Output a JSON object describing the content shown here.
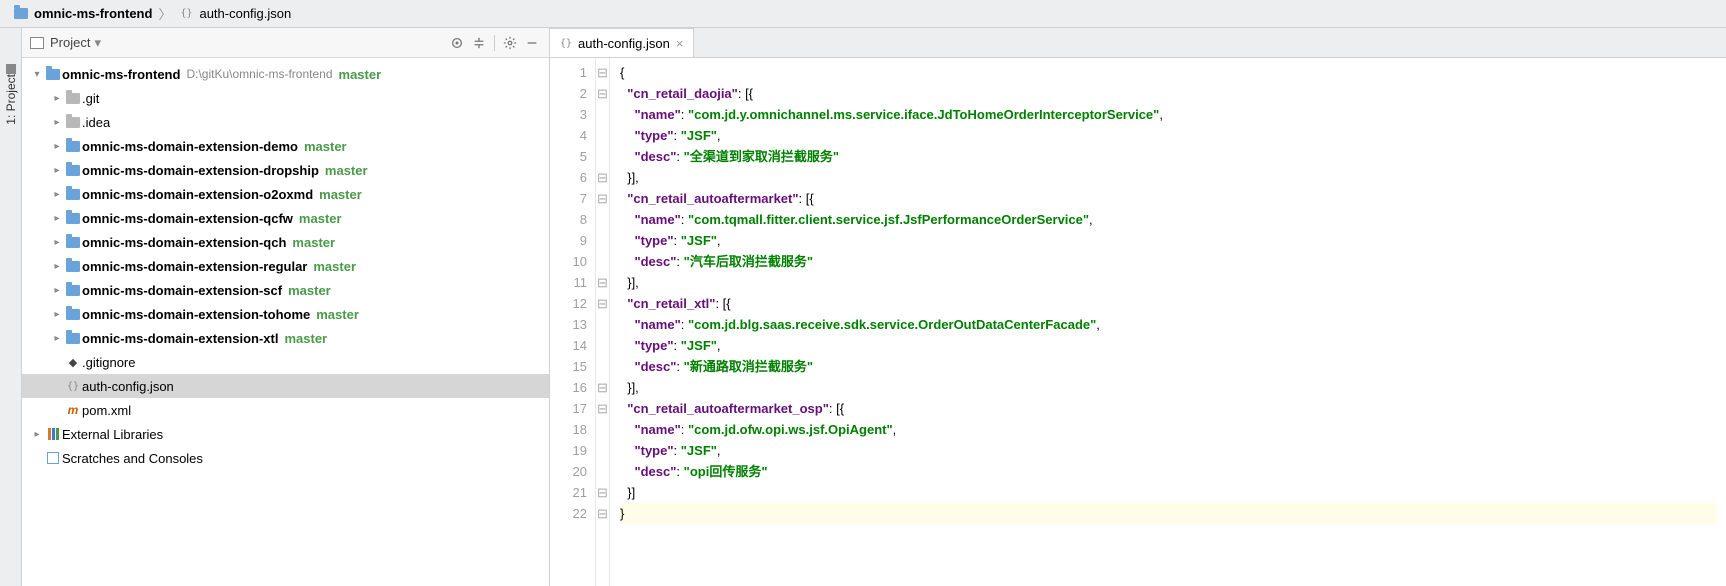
{
  "breadcrumb": [
    {
      "icon": "folder",
      "label": "omnic-ms-frontend"
    },
    {
      "icon": "json",
      "label": "auth-config.json"
    }
  ],
  "sideTab": {
    "label": "1: Project"
  },
  "panel": {
    "title": "Project"
  },
  "tree": [
    {
      "depth": 0,
      "chev": "down",
      "icon": "folder",
      "bold": true,
      "label": "omnic-ms-frontend",
      "path": "D:\\gitKu\\omnic-ms-frontend",
      "branch": "master"
    },
    {
      "depth": 1,
      "chev": "right",
      "icon": "folder-grey",
      "bold": false,
      "label": ".git",
      "path": "",
      "branch": ""
    },
    {
      "depth": 1,
      "chev": "right",
      "icon": "folder-grey",
      "bold": false,
      "label": ".idea",
      "path": "",
      "branch": ""
    },
    {
      "depth": 1,
      "chev": "right",
      "icon": "folder",
      "bold": true,
      "label": "omnic-ms-domain-extension-demo",
      "path": "",
      "branch": "master"
    },
    {
      "depth": 1,
      "chev": "right",
      "icon": "folder",
      "bold": true,
      "label": "omnic-ms-domain-extension-dropship",
      "path": "",
      "branch": "master"
    },
    {
      "depth": 1,
      "chev": "right",
      "icon": "folder",
      "bold": true,
      "label": "omnic-ms-domain-extension-o2oxmd",
      "path": "",
      "branch": "master"
    },
    {
      "depth": 1,
      "chev": "right",
      "icon": "folder",
      "bold": true,
      "label": "omnic-ms-domain-extension-qcfw",
      "path": "",
      "branch": "master"
    },
    {
      "depth": 1,
      "chev": "right",
      "icon": "folder",
      "bold": true,
      "label": "omnic-ms-domain-extension-qch",
      "path": "",
      "branch": "master"
    },
    {
      "depth": 1,
      "chev": "right",
      "icon": "folder",
      "bold": true,
      "label": "omnic-ms-domain-extension-regular",
      "path": "",
      "branch": "master"
    },
    {
      "depth": 1,
      "chev": "right",
      "icon": "folder",
      "bold": true,
      "label": "omnic-ms-domain-extension-scf",
      "path": "",
      "branch": "master"
    },
    {
      "depth": 1,
      "chev": "right",
      "icon": "folder",
      "bold": true,
      "label": "omnic-ms-domain-extension-tohome",
      "path": "",
      "branch": "master"
    },
    {
      "depth": 1,
      "chev": "right",
      "icon": "folder",
      "bold": true,
      "label": "omnic-ms-domain-extension-xtl",
      "path": "",
      "branch": "master"
    },
    {
      "depth": 1,
      "chev": "none",
      "icon": "git",
      "bold": false,
      "label": ".gitignore",
      "path": "",
      "branch": ""
    },
    {
      "depth": 1,
      "chev": "none",
      "icon": "json",
      "bold": false,
      "label": "auth-config.json",
      "path": "",
      "branch": "",
      "selected": true
    },
    {
      "depth": 1,
      "chev": "none",
      "icon": "xml",
      "bold": false,
      "label": "pom.xml",
      "path": "",
      "branch": ""
    },
    {
      "depth": 0,
      "chev": "right",
      "icon": "lib",
      "bold": false,
      "label": "External Libraries",
      "path": "",
      "branch": ""
    },
    {
      "depth": 0,
      "chev": "none",
      "icon": "scratch",
      "bold": false,
      "label": "Scratches and Consoles",
      "path": "",
      "branch": ""
    }
  ],
  "tab": {
    "label": "auth-config.json"
  },
  "code": {
    "lines": [
      [
        [
          "pun",
          "",
          "hl-open"
        ],
        [
          "brace",
          "{",
          ""
        ]
      ],
      [
        [
          "pun",
          "  "
        ],
        [
          "key",
          "\"cn_retail_daojia\""
        ],
        [
          "pun",
          ": [{"
        ]
      ],
      [
        [
          "pun",
          "    "
        ],
        [
          "key",
          "\"name\""
        ],
        [
          "pun",
          ": "
        ],
        [
          "str",
          "\"com.jd.y.omnichannel.ms.service.iface.JdToHomeOrderInterceptorService\""
        ],
        [
          "pun",
          ","
        ]
      ],
      [
        [
          "pun",
          "    "
        ],
        [
          "key",
          "\"type\""
        ],
        [
          "pun",
          ": "
        ],
        [
          "str",
          "\"JSF\""
        ],
        [
          "pun",
          ","
        ]
      ],
      [
        [
          "pun",
          "    "
        ],
        [
          "key",
          "\"desc\""
        ],
        [
          "pun",
          ": "
        ],
        [
          "str",
          "\"全渠道到家取消拦截服务\""
        ]
      ],
      [
        [
          "pun",
          "  }],"
        ]
      ],
      [
        [
          "pun",
          "  "
        ],
        [
          "key",
          "\"cn_retail_autoaftermarket\""
        ],
        [
          "pun",
          ": [{"
        ]
      ],
      [
        [
          "pun",
          "    "
        ],
        [
          "key",
          "\"name\""
        ],
        [
          "pun",
          ": "
        ],
        [
          "str",
          "\"com.tqmall.fitter.client.service.jsf.JsfPerformanceOrderService\""
        ],
        [
          "pun",
          ","
        ]
      ],
      [
        [
          "pun",
          "    "
        ],
        [
          "key",
          "\"type\""
        ],
        [
          "pun",
          ": "
        ],
        [
          "str",
          "\"JSF\""
        ],
        [
          "pun",
          ","
        ]
      ],
      [
        [
          "pun",
          "    "
        ],
        [
          "key",
          "\"desc\""
        ],
        [
          "pun",
          ": "
        ],
        [
          "str",
          "\"汽车后取消拦截服务\""
        ]
      ],
      [
        [
          "pun",
          "  }],"
        ]
      ],
      [
        [
          "pun",
          "  "
        ],
        [
          "key",
          "\"cn_retail_xtl\""
        ],
        [
          "pun",
          ": [{"
        ]
      ],
      [
        [
          "pun",
          "    "
        ],
        [
          "key",
          "\"name\""
        ],
        [
          "pun",
          ": "
        ],
        [
          "str",
          "\"com.jd.blg.saas.receive.sdk.service.OrderOutDataCenterFacade\""
        ],
        [
          "pun",
          ","
        ]
      ],
      [
        [
          "pun",
          "    "
        ],
        [
          "key",
          "\"type\""
        ],
        [
          "pun",
          ": "
        ],
        [
          "str",
          "\"JSF\""
        ],
        [
          "pun",
          ","
        ]
      ],
      [
        [
          "pun",
          "    "
        ],
        [
          "key",
          "\"desc\""
        ],
        [
          "pun",
          ": "
        ],
        [
          "str",
          "\"新通路取消拦截服务\""
        ]
      ],
      [
        [
          "pun",
          "  }],"
        ]
      ],
      [
        [
          "pun",
          "  "
        ],
        [
          "key",
          "\"cn_retail_autoaftermarket_osp\""
        ],
        [
          "pun",
          ": [{"
        ]
      ],
      [
        [
          "pun",
          "    "
        ],
        [
          "key",
          "\"name\""
        ],
        [
          "pun",
          ": "
        ],
        [
          "str",
          "\"com.jd.ofw.opi.ws.jsf.OpiAgent\""
        ],
        [
          "pun",
          ","
        ]
      ],
      [
        [
          "pun",
          "    "
        ],
        [
          "key",
          "\"type\""
        ],
        [
          "pun",
          ": "
        ],
        [
          "str",
          "\"JSF\""
        ],
        [
          "pun",
          ","
        ]
      ],
      [
        [
          "pun",
          "    "
        ],
        [
          "key",
          "\"desc\""
        ],
        [
          "pun",
          ": "
        ],
        [
          "str",
          "\"opi回传服务\""
        ]
      ],
      [
        [
          "pun",
          "  }]"
        ]
      ],
      [
        [
          "pun",
          "",
          "hl-close"
        ],
        [
          "brace",
          "}",
          "caret-line"
        ]
      ]
    ]
  }
}
